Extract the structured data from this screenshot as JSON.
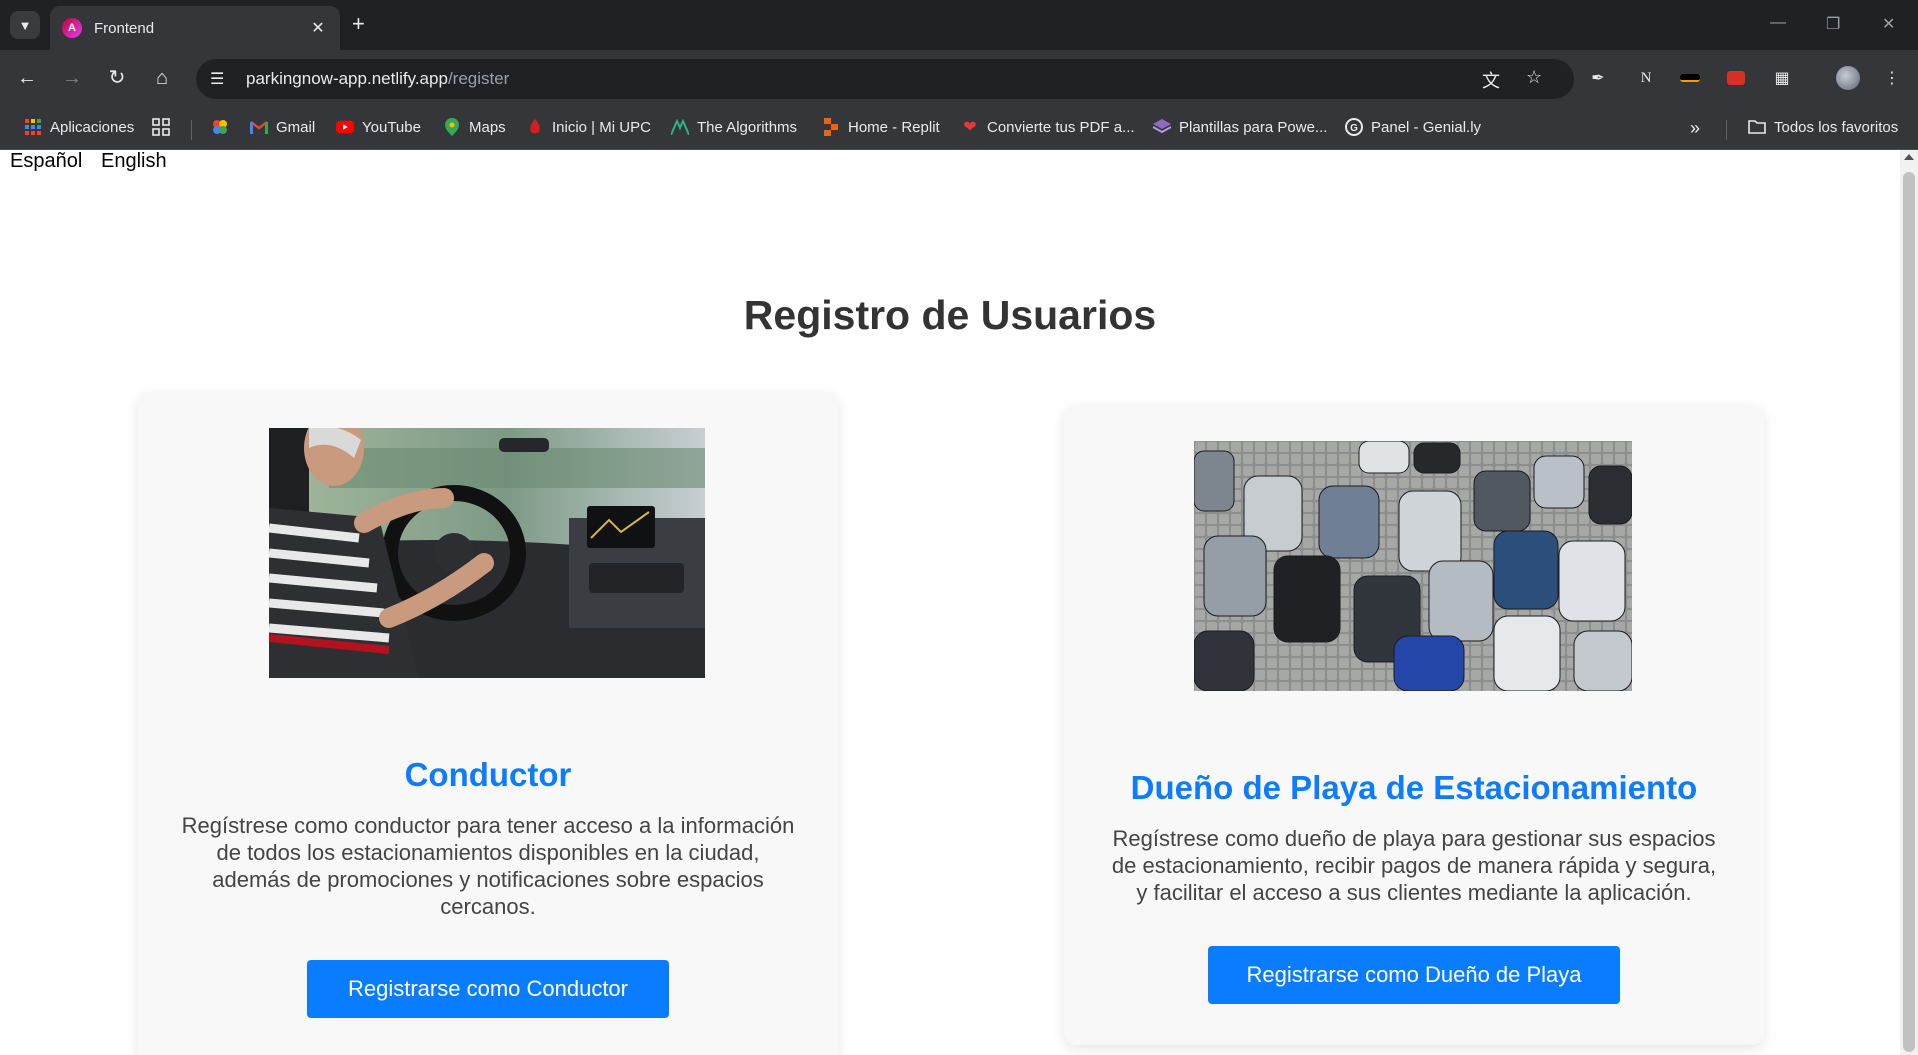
{
  "browser": {
    "tab_title": "Frontend",
    "url_host": "parkingnow-app.netlify.app",
    "url_path": "/register",
    "bookmarks": [
      {
        "label": "Aplicaciones",
        "icon": "apps-grid-icon"
      },
      {
        "label": "",
        "icon": "tab-groups-icon"
      },
      {
        "label": "",
        "icon": "google-photos-icon"
      },
      {
        "label": "Gmail",
        "icon": "gmail-icon"
      },
      {
        "label": "YouTube",
        "icon": "youtube-icon"
      },
      {
        "label": "Maps",
        "icon": "maps-icon"
      },
      {
        "label": "Inicio | Mi UPC",
        "icon": "upc-icon"
      },
      {
        "label": "The Algorithms",
        "icon": "algorithms-icon"
      },
      {
        "label": "Home - Replit",
        "icon": "replit-icon"
      },
      {
        "label": "Convierte tus PDF a...",
        "icon": "pdf-heart-icon"
      },
      {
        "label": "Plantillas para Powe...",
        "icon": "slides-icon"
      },
      {
        "label": "Panel - Genial.ly",
        "icon": "genially-icon"
      }
    ],
    "all_bookmarks_label": "Todos los favoritos"
  },
  "page": {
    "languages": [
      "Español",
      "English"
    ],
    "title": "Registro de Usuarios",
    "cards": [
      {
        "title": "Conductor",
        "description": "Regístrese como conductor para tener acceso a la información de todos los estacionamientos disponibles en la ciudad, además de promociones y notificaciones sobre espacios cercanos.",
        "button": "Registrarse como Conductor",
        "image": "driver-photo"
      },
      {
        "title": "Dueño de Playa de Estacionamiento",
        "description": "Regístrese como dueño de playa para gestionar sus espacios de estacionamiento, recibir pagos de manera rápida y segura, y facilitar el acceso a sus clientes mediante la aplicación.",
        "button": "Registrarse como Dueño de Playa",
        "image": "parking-lot-photo"
      }
    ]
  },
  "colors": {
    "accent": "#0a7cff",
    "title_blue": "#0d7cff",
    "card_bg": "#f8f8f8",
    "heading": "#333333"
  }
}
